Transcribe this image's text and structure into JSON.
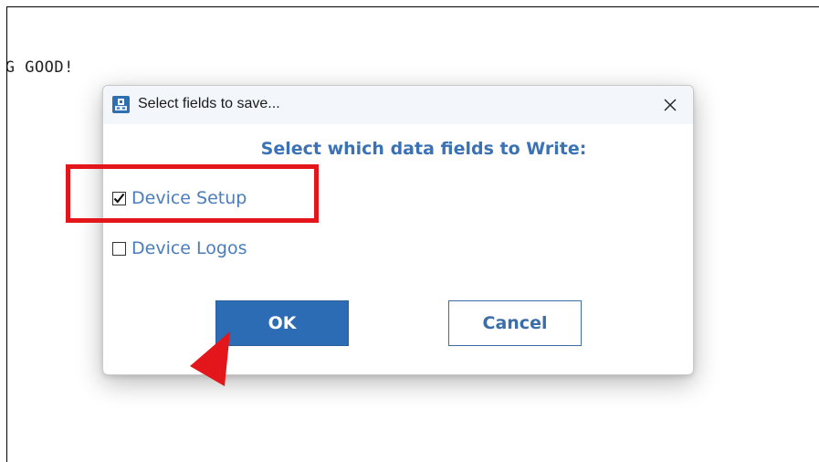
{
  "background": {
    "console_text": "NG GOOD!"
  },
  "dialog": {
    "title": "Select fields to save...",
    "app_icon": "app-icon",
    "close_icon": "close-icon",
    "heading": "Select which data fields to Write:",
    "options": [
      {
        "label": "Device Setup",
        "checked": true
      },
      {
        "label": "Device Logos",
        "checked": false
      }
    ],
    "ok_label": "OK",
    "cancel_label": "Cancel"
  },
  "colors": {
    "accent": "#2c6cb5",
    "heading": "#3a72b5",
    "annotation": "#e3161b"
  }
}
